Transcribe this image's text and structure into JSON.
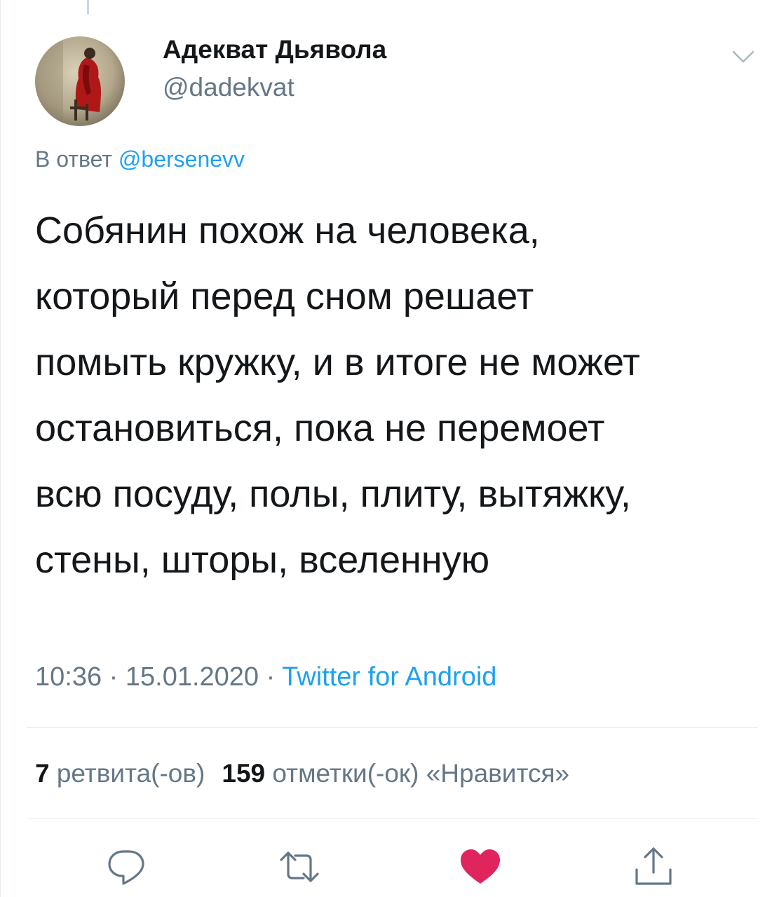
{
  "tweet": {
    "author": {
      "display_name": "Адекват Дьявола",
      "handle": "@dadekvat"
    },
    "reply_to": {
      "prefix": "В ответ",
      "mention": "@bersenevv"
    },
    "text_lines": [
      "Собянин похож на человека,",
      "который перед сном решает",
      "помыть кружку, и в итоге не может",
      "остановиться, пока не перемоет",
      "всю посуду, полы, плиту, вытяжку,",
      "стены, шторы, вселенную"
    ],
    "time": "10:36",
    "date": "15.01.2020",
    "separator": "·",
    "source": "Twitter for Android",
    "stats": {
      "retweets_count": "7",
      "retweets_label": "ретвита(-ов)",
      "likes_count": "159",
      "likes_label": "отметки(-ок) «Нравится»"
    }
  },
  "actions": {
    "reply_icon": "comment-bubble-icon",
    "retweet_icon": "retweet-arrows-icon",
    "like_icon": "heart-icon",
    "share_icon": "share-upload-icon"
  },
  "colors": {
    "accent": "#1da1f2",
    "secondary_text": "#657786",
    "primary_text": "#14171a",
    "like_active": "#e0245e"
  }
}
